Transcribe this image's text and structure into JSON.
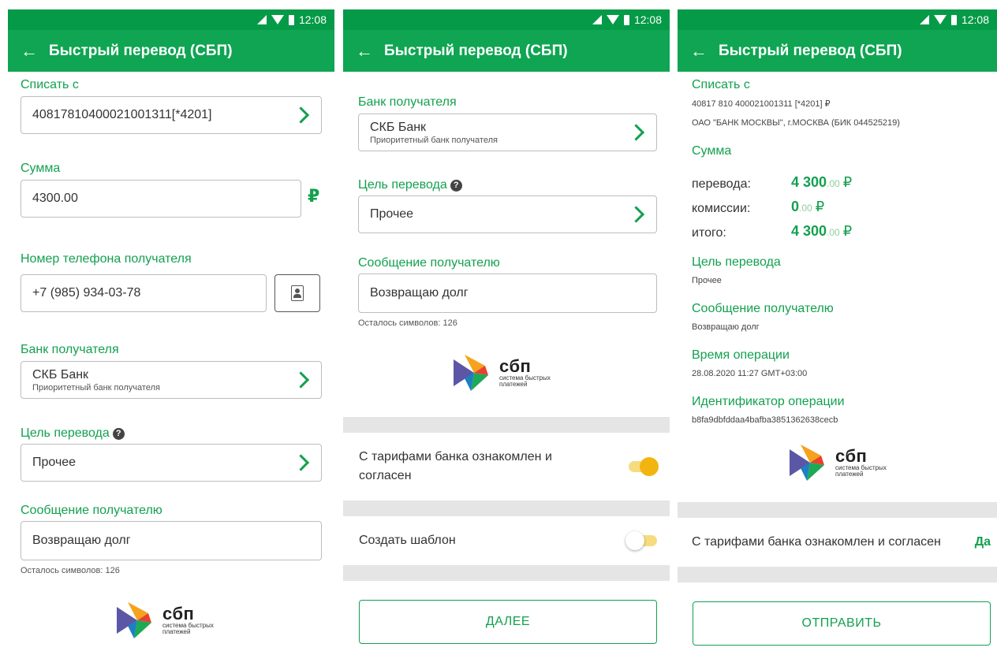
{
  "status": {
    "time": "12:08"
  },
  "appbar": {
    "back": "←",
    "title": "Быстрый перевод (СБП)"
  },
  "screen1": {
    "from_label": "Списать с",
    "from_value": "40817810400021001311[*4201]",
    "amount_label": "Сумма",
    "amount_value": "4300.00",
    "currency": "₽",
    "phone_label": "Номер телефона получателя",
    "phone_value": "+7 (985) 934-03-78",
    "bank_label": "Банк получателя",
    "bank_value": "СКБ Банк",
    "bank_sub": "Приоритетный банк получателя",
    "purpose_label": "Цель перевода",
    "purpose_value": "Прочее",
    "message_label": "Сообщение получателю",
    "message_value": "Возвращаю долг",
    "chars_left": "Осталось символов: 126"
  },
  "screen2": {
    "bank_label": "Банк получателя",
    "bank_value": "СКБ Банк",
    "bank_sub": "Приоритетный банк получателя",
    "purpose_label": "Цель перевода",
    "purpose_value": "Прочее",
    "message_label": "Сообщение получателю",
    "message_value": "Возвращаю долг",
    "chars_left": "Осталось символов: 126",
    "tariffs_text": "С тарифами банка ознакомлен и согласен",
    "tariffs_on": true,
    "template_text": "Создать шаблон",
    "template_on": false,
    "next_button": "ДАЛЕЕ"
  },
  "screen3": {
    "from_label": "Списать с",
    "from_account": "40817 810 400021001311 [*4201] ₽",
    "from_bank": "ОАО \"БАНК МОСКВЫ\", г.МОСКВА (БИК 044525219)",
    "amount_label": "Сумма",
    "transfer_label": "перевода:",
    "transfer_int": "4 300",
    "transfer_cents": ".00",
    "fee_label": "комиссии:",
    "fee_int": "0",
    "fee_cents": ".00",
    "total_label": "итого:",
    "total_int": "4 300",
    "total_cents": ".00",
    "currency": "₽",
    "purpose_label": "Цель перевода",
    "purpose_value": "Прочее",
    "message_label": "Сообщение получателю",
    "message_value": "Возвращаю долг",
    "time_label": "Время операции",
    "time_value": "28.08.2020 11:27 GMT+03:00",
    "id_label": "Идентификатор операции",
    "id_value": "b8fa9dbfddaa4bafba3851362638cecb",
    "tariffs_text": "С тарифами банка ознакомлен и согласен",
    "tariffs_answer": "Да",
    "send_button": "ОТПРАВИТЬ"
  },
  "logo": {
    "name": "сбп",
    "tagline_1": "система быстрых",
    "tagline_2": "платежей"
  },
  "colors": {
    "statusbar": "#059a47",
    "appbar": "#0fa552",
    "accent": "#13a04f",
    "toggle_on": "#f2b50f",
    "divider": "#e5e5e5"
  },
  "icons": [
    "back-arrow-icon",
    "chevron-right-icon",
    "help-icon",
    "contacts-icon",
    "signal-icon",
    "wifi-icon",
    "battery-icon",
    "sbp-logo"
  ]
}
